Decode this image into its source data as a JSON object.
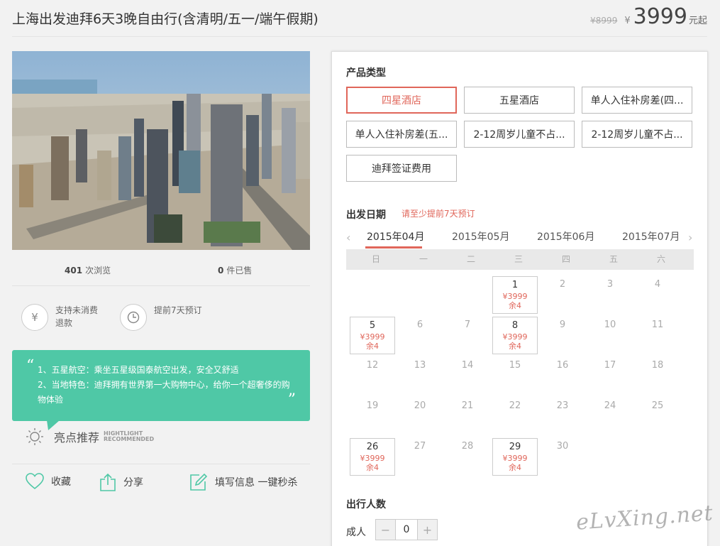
{
  "header": {
    "title": "上海出发迪拜6天3晚自由行(含清明/五一/端午假期)",
    "old_price": "¥8999",
    "currency": "¥",
    "price": "3999",
    "price_suffix": "元起"
  },
  "stats": {
    "views_num": "401",
    "views_label": "次浏览",
    "sold_num": "0",
    "sold_label": "件已售"
  },
  "features": [
    {
      "icon": "yen-circle-icon",
      "label": "支持未消费退款"
    },
    {
      "icon": "clock-icon",
      "label": "提前7天预订"
    }
  ],
  "highlights": {
    "line1": "1、五星航空：乘坐五星级国泰航空出发，安全又舒适",
    "line2": "2、当地特色：迪拜拥有世界第一大购物中心，给你一个超奢侈的购物体验",
    "title": "亮点推荐",
    "en1": "HIGHTLIGHT",
    "en2": "RECOMMENDED"
  },
  "actions": {
    "favorite": "收藏",
    "share": "分享",
    "fill_info": "填写信息 一键秒杀"
  },
  "product": {
    "section_title": "产品类型",
    "options": [
      "四星酒店",
      "五星酒店",
      "单人入住补房差(四...",
      "单人入住补房差(五...",
      "2-12周岁儿童不占...",
      "2-12周岁儿童不占...",
      "迪拜签证费用"
    ],
    "selected_index": 0
  },
  "departure": {
    "section_title": "出发日期",
    "hint": "请至少提前7天预订",
    "months": [
      "2015年04月",
      "2015年05月",
      "2015年06月",
      "2015年07月"
    ],
    "selected_month": 0,
    "weekdays": [
      "日",
      "一",
      "二",
      "三",
      "四",
      "五",
      "六"
    ],
    "price_text": "¥3999",
    "remain_text": "余4",
    "days": [
      {
        "d": "1",
        "av": true
      },
      {
        "d": "2"
      },
      {
        "d": "3"
      },
      {
        "d": "4"
      },
      {
        "d": "5",
        "av": true
      },
      {
        "d": "6"
      },
      {
        "d": "7"
      },
      {
        "d": "8",
        "av": true
      },
      {
        "d": "9"
      },
      {
        "d": "10"
      },
      {
        "d": "11"
      },
      {
        "d": "12"
      },
      {
        "d": "13"
      },
      {
        "d": "14"
      },
      {
        "d": "15"
      },
      {
        "d": "16"
      },
      {
        "d": "17"
      },
      {
        "d": "18"
      },
      {
        "d": "19"
      },
      {
        "d": "20"
      },
      {
        "d": "21"
      },
      {
        "d": "22"
      },
      {
        "d": "23"
      },
      {
        "d": "24"
      },
      {
        "d": "25"
      },
      {
        "d": "26",
        "av": true
      },
      {
        "d": "27"
      },
      {
        "d": "28"
      },
      {
        "d": "29",
        "av": true
      },
      {
        "d": "30"
      }
    ]
  },
  "travelers": {
    "section_title": "出行人数",
    "adult_label": "成人",
    "minus": "−",
    "plus": "+",
    "adult_count": "0"
  },
  "watermark": "eLvXing.net",
  "colors": {
    "accent": "#e0665a",
    "teal": "#4fc8a6"
  }
}
